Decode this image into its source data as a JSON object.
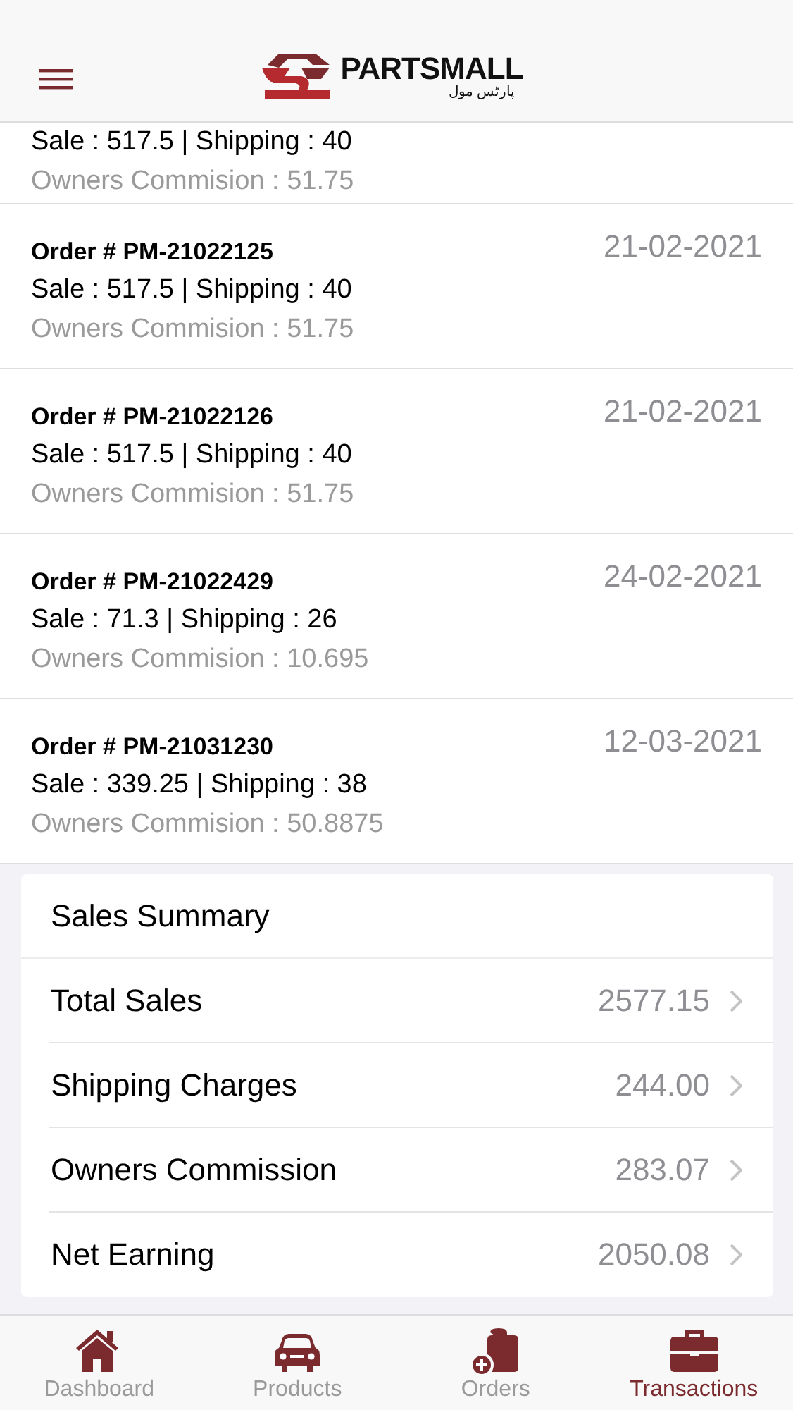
{
  "header": {
    "logo": {
      "wordmark": "PARTSMALL",
      "tagline": "پارٹس مول"
    }
  },
  "orders": [
    {
      "sale": "Sale : 517.5 | Shipping : 40",
      "commission": "Owners Commision : 51.75"
    },
    {
      "order": "Order # PM-21022125",
      "sale": "Sale : 517.5 | Shipping : 40",
      "commission": "Owners Commision : 51.75",
      "date": "21-02-2021"
    },
    {
      "order": "Order # PM-21022126",
      "sale": "Sale : 517.5 | Shipping : 40",
      "commission": "Owners Commision : 51.75",
      "date": "21-02-2021"
    },
    {
      "order": "Order # PM-21022429",
      "sale": "Sale : 71.3 | Shipping : 26",
      "commission": "Owners Commision : 10.695",
      "date": "24-02-2021"
    },
    {
      "order": "Order # PM-21031230",
      "sale": "Sale : 339.25 | Shipping : 38",
      "commission": "Owners Commision : 50.8875",
      "date": "12-03-2021"
    }
  ],
  "summary": {
    "title": "Sales Summary",
    "rows": [
      {
        "label": "Total Sales",
        "value": "2577.15"
      },
      {
        "label": "Shipping Charges",
        "value": "244.00"
      },
      {
        "label": "Owners Commission",
        "value": "283.07"
      },
      {
        "label": "Net Earning",
        "value": "2050.08"
      }
    ]
  },
  "tabs": [
    {
      "kind": "home",
      "label": "Dashboard",
      "selected": false
    },
    {
      "kind": "car",
      "label": "Products",
      "selected": false
    },
    {
      "kind": "orders",
      "label": "Orders",
      "selected": false
    },
    {
      "kind": "briefcase",
      "label": "Transactions",
      "selected": true
    }
  ]
}
